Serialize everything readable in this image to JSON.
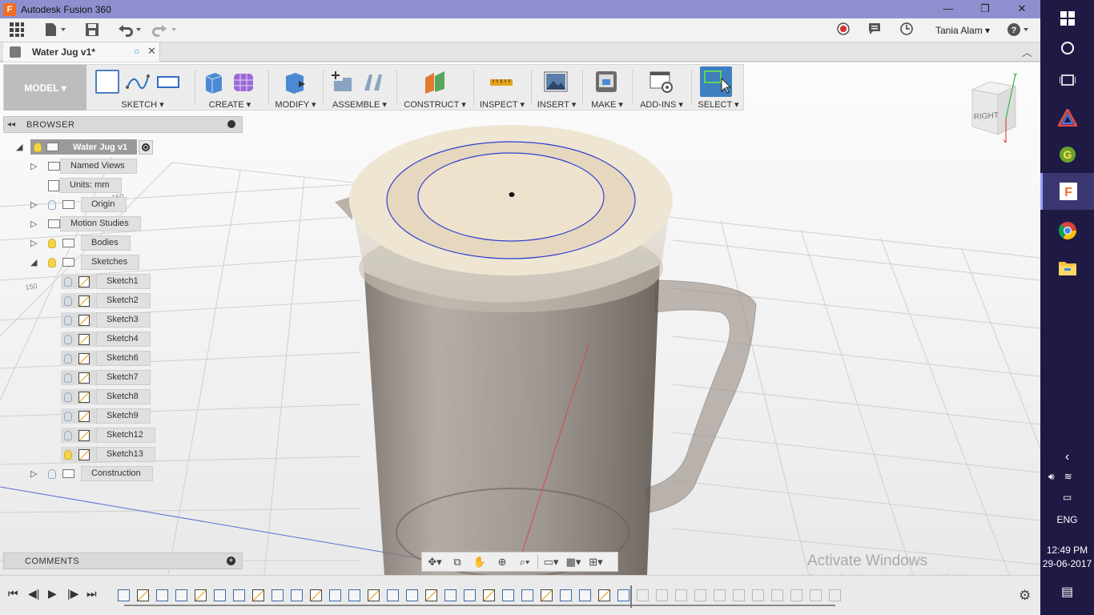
{
  "window": {
    "title": "Autodesk Fusion 360",
    "app_icon_letter": "F",
    "minimize_glyph": "—",
    "maximize_glyph": "❐",
    "close_glyph": "✕"
  },
  "quick_toolbar": {
    "user_name": "Tania Alam",
    "icons": [
      "data-panel-icon",
      "file-icon",
      "save-icon",
      "undo-icon",
      "redo-icon",
      "record-icon",
      "comment-icon",
      "history-icon",
      "help-icon"
    ]
  },
  "document_tab": {
    "name": "Water Jug v1*"
  },
  "ribbon": {
    "workspace": "MODEL ▾",
    "groups": [
      {
        "label": "SKETCH ▾"
      },
      {
        "label": "CREATE ▾"
      },
      {
        "label": "MODIFY ▾"
      },
      {
        "label": "ASSEMBLE ▾"
      },
      {
        "label": "CONSTRUCT ▾"
      },
      {
        "label": "INSPECT ▾"
      },
      {
        "label": "INSERT ▾"
      },
      {
        "label": "MAKE ▾"
      },
      {
        "label": "ADD-INS ▾"
      },
      {
        "label": "SELECT ▾"
      }
    ]
  },
  "browser": {
    "title": "BROWSER",
    "root": "Water Jug v1",
    "items": {
      "named_views": "Named Views",
      "units": "Units: mm",
      "origin": "Origin",
      "motion_studies": "Motion Studies",
      "bodies": "Bodies",
      "sketches": "Sketches",
      "construction": "Construction"
    },
    "sketches": [
      "Sketch1",
      "Sketch2",
      "Sketch3",
      "Sketch4",
      "Sketch6",
      "Sketch7",
      "Sketch8",
      "Sketch9",
      "Sketch12",
      "Sketch13"
    ]
  },
  "comments": {
    "title": "COMMENTS"
  },
  "viewcube": {
    "face": "RIGHT",
    "axis_y": "Y",
    "axis_x": "X"
  },
  "grid_labels": {
    "a": "150",
    "b": "150"
  },
  "watermark": {
    "line1": "Activate Windows",
    "line2": "Go to Settings to activate Windows."
  },
  "taskbar": {
    "lang": "ENG",
    "time": "12:49 PM",
    "date": "29-06-2017"
  },
  "colors": {
    "titlebar": "#8f8fcf",
    "select_active": "#3f7fbf",
    "taskbar_bg": "#1e1a44",
    "jug_body": "#8a7e74",
    "lid": "#efe5d3"
  }
}
